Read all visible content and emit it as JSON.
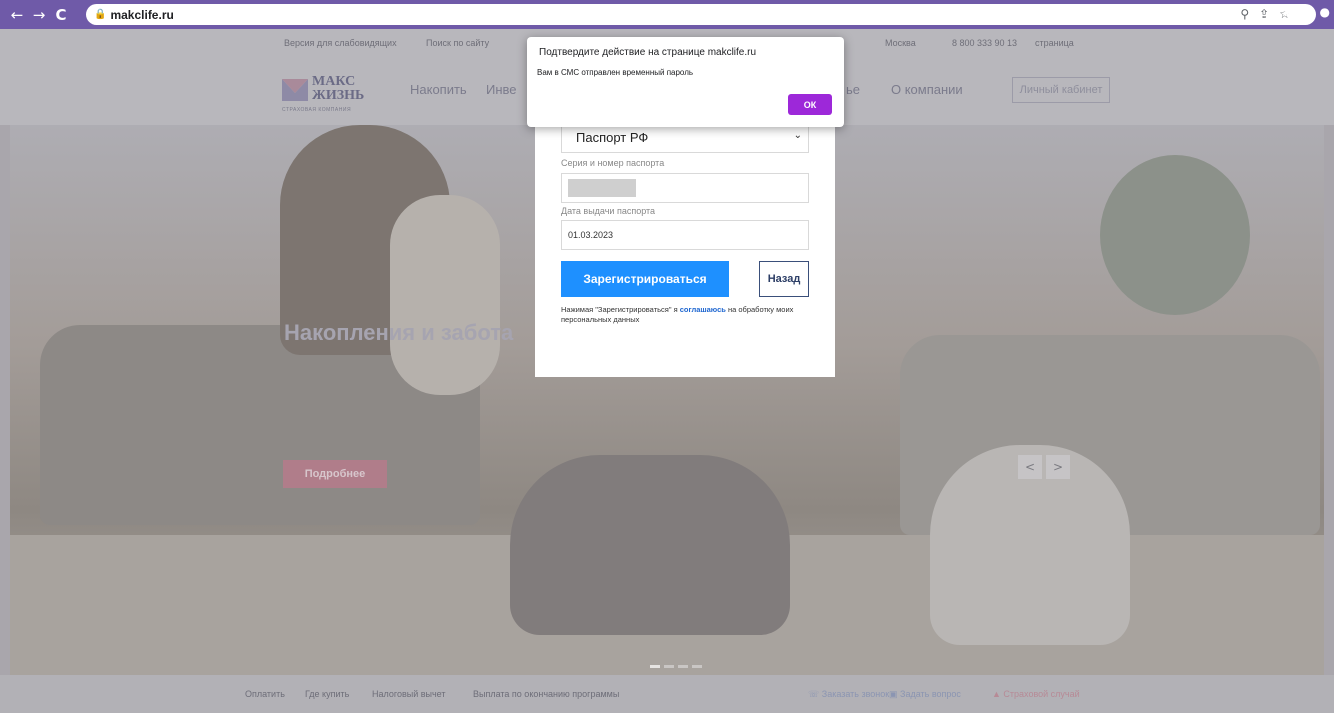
{
  "browser": {
    "url": "makclife.ru",
    "back_icon": "←",
    "forward_icon": "→",
    "reload_icon": "C",
    "lock_icon": "🔒",
    "zoom_icon": "⚲",
    "share_icon": "⇪",
    "star_icon": "☆",
    "ext_icons": [
      "✱",
      "▢",
      "●"
    ]
  },
  "topbar": {
    "accessibility": "Версия для слабовидящих",
    "search": "Поиск по сайту",
    "city": "Москва",
    "phone": "8 800 333 90 13",
    "page_link": "страница"
  },
  "header": {
    "logo_line1": "МАКС",
    "logo_line2": "ЖИЗНЬ",
    "logo_sub": "СТРАХОВАЯ КОМПАНИЯ",
    "menu": [
      "Накопить",
      "Инве",
      "ье",
      "О компании"
    ],
    "cabinet": "Личный кабинет"
  },
  "hero": {
    "title": "Накопления и забота",
    "more_button": "Подробнее",
    "prev": "<",
    "next": ">"
  },
  "footer": {
    "links": [
      "Оплатить",
      "Где купить",
      "Налоговый вычет",
      "Выплата по окончанию программы"
    ],
    "callback": "Заказать звонок",
    "question": "Задать вопрос",
    "insurance": "Страховой случай"
  },
  "form": {
    "document_type": "Паспорт РФ",
    "passport_label": "Серия и номер паспорта",
    "issue_date_label": "Дата выдачи паспорта",
    "issue_date_value": "01.03.2023",
    "register_button": "Зарегистрироваться",
    "back_button": "Назад",
    "consent_prefix": "Нажимая \"Зарегистрироваться\" я ",
    "consent_link": "соглашаюсь",
    "consent_suffix": " на обработку моих персональных данных"
  },
  "dialog": {
    "title": "Подтвердите действие на странице makclife.ru",
    "message": "Вам в СМС отправлен временный пароль",
    "ok": "ОК"
  },
  "colors": {
    "chrome": "#6f5aa8",
    "primary_button": "#1e90ff",
    "dialog_ok": "#9d28d9"
  }
}
